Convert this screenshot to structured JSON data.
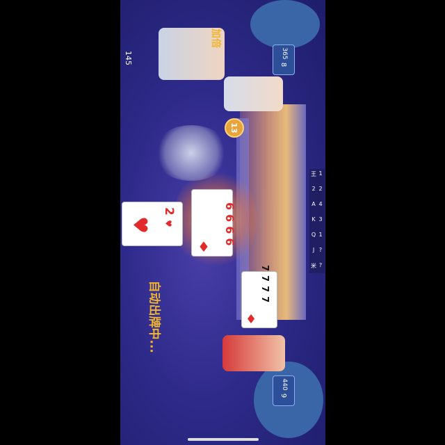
{
  "timer": "145",
  "players": {
    "left": {
      "score": "365",
      "cards_left": "8",
      "status": "加倍"
    },
    "right_bottom": {
      "score": "440",
      "cards_left": "9"
    }
  },
  "turn_countdown": "13",
  "played": {
    "left_player": {
      "ranks": [
        "6",
        "6",
        "6",
        "6"
      ]
    },
    "self": {
      "ranks": [
        "7",
        "7",
        "7",
        "7"
      ]
    },
    "center_card": {
      "rank": "2",
      "suit": "♥"
    }
  },
  "auto_play_text": "自动出牌中...",
  "tracker": {
    "ranks": [
      "王",
      "2",
      "A",
      "K",
      "Q",
      "J",
      "米"
    ],
    "counts": [
      "1",
      "2",
      "4",
      "3",
      "1",
      "?",
      "?"
    ]
  },
  "colors": {
    "card_red": "#e12b2b",
    "badge_blue": "#2d4f9a",
    "status_gold": "#f1b52b"
  }
}
